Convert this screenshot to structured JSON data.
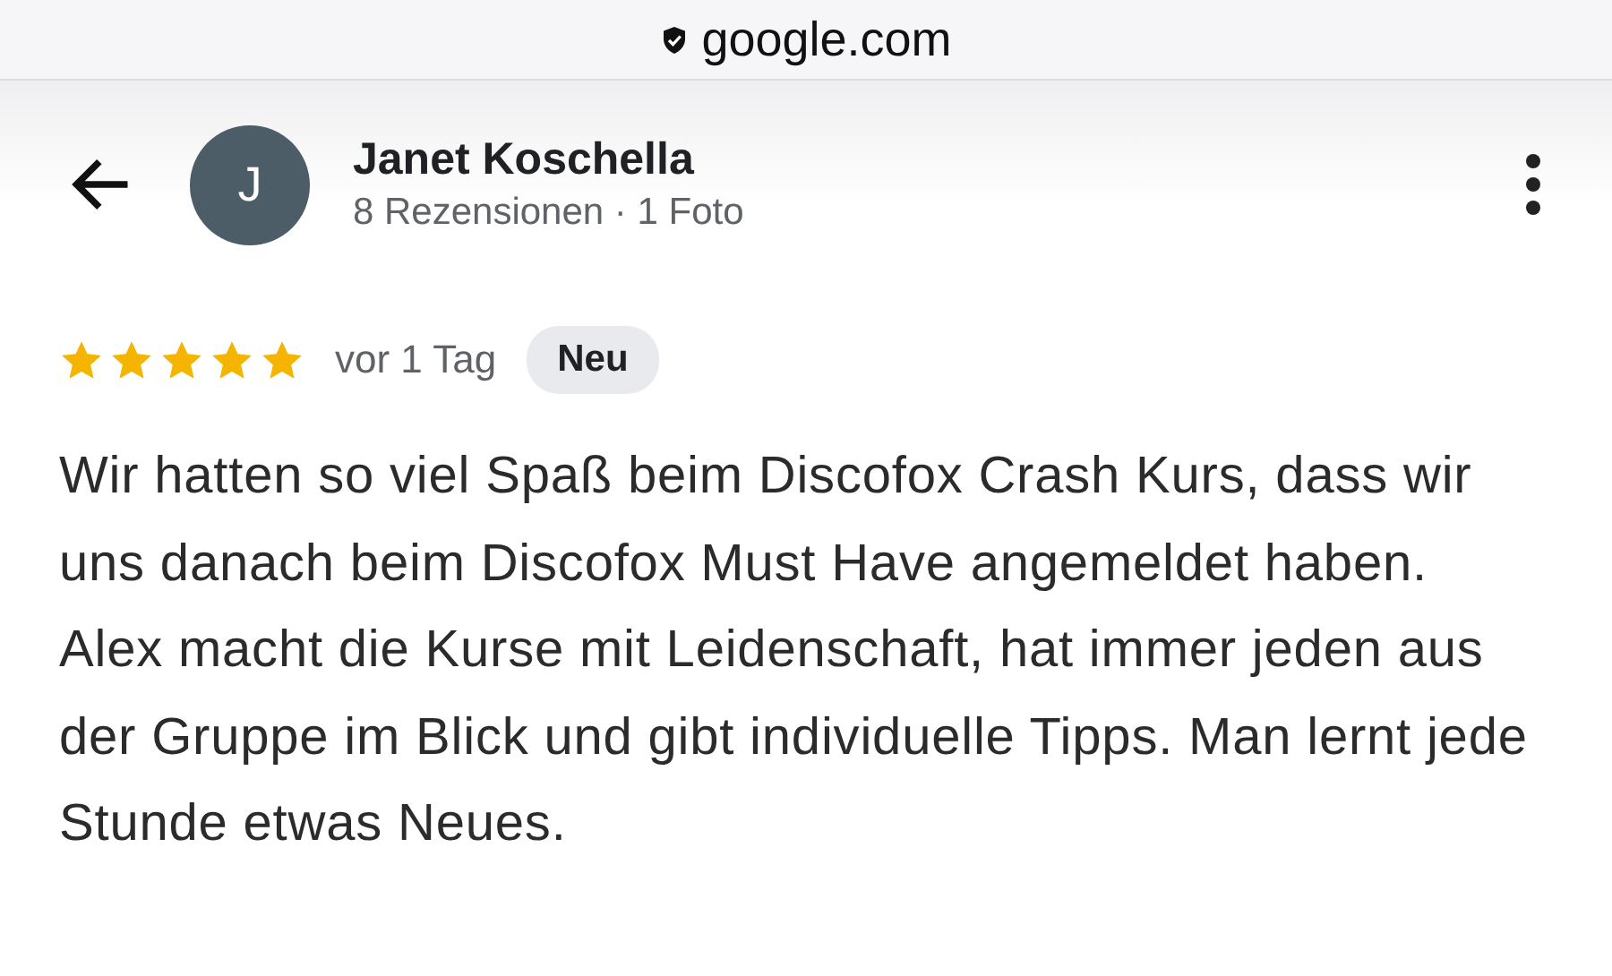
{
  "address_bar": {
    "url": "google.com",
    "secure": true
  },
  "reviewer": {
    "initial": "J",
    "name": "Janet Koschella",
    "stats": "8 Rezensionen · 1 Foto"
  },
  "review": {
    "stars": 5,
    "time": "vor 1 Tag",
    "badge": "Neu",
    "paragraphs": [
      "Wir hatten so viel Spaß beim Discofox Crash Kurs, dass wir uns danach beim Discofox Must Have angemeldet haben.",
      "Alex macht die Kurse mit Leidenschaft, hat immer jeden aus der Gruppe im Blick und gibt individuelle Tipps. Man lernt jede Stunde etwas Neues."
    ]
  }
}
